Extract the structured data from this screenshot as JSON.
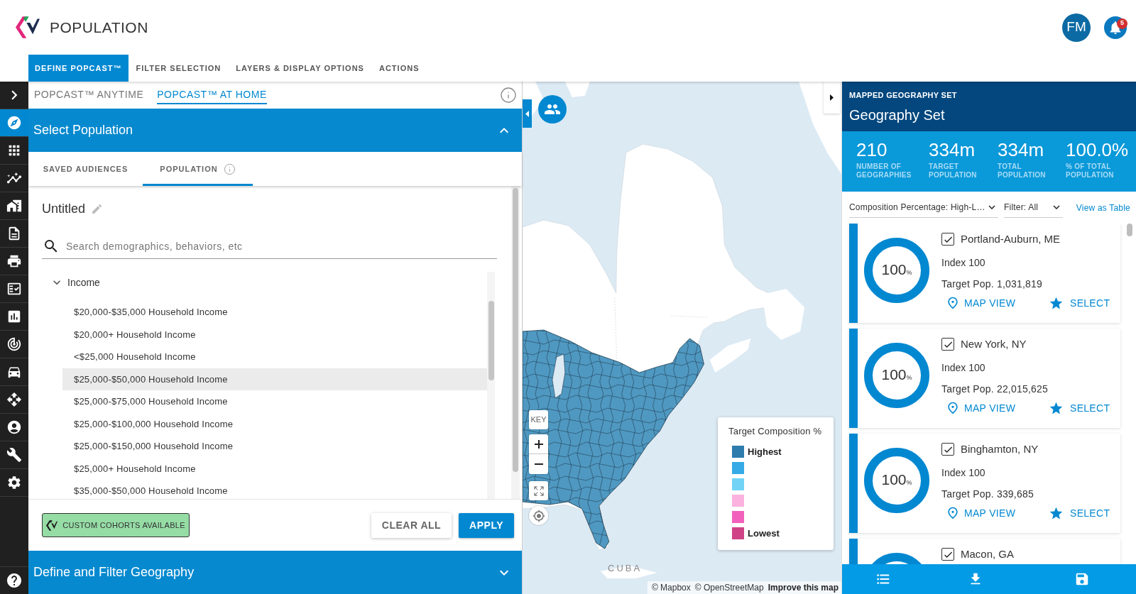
{
  "header": {
    "app_title": "POPULATION",
    "avatar_initials": "FM",
    "notification_count": "5"
  },
  "main_tabs": [
    {
      "label": "DEFINE POPCAST™",
      "selected": true
    },
    {
      "label": "FILTER SELECTION",
      "selected": false
    },
    {
      "label": "LAYERS & DISPLAY OPTIONS",
      "selected": false
    },
    {
      "label": "ACTIONS",
      "selected": false
    }
  ],
  "sidebar": {
    "items": [
      {
        "selected": true
      },
      {
        "selected": false
      },
      {
        "selected": false
      },
      {
        "selected": false
      },
      {
        "selected": false
      },
      {
        "selected": false
      },
      {
        "selected": false
      },
      {
        "selected": false
      },
      {
        "selected": false
      },
      {
        "selected": false
      },
      {
        "selected": false
      },
      {
        "selected": false
      },
      {
        "selected": false
      },
      {
        "selected": false
      }
    ]
  },
  "left_panel": {
    "subtabs": [
      {
        "label": "POPCAST™ ANYTIME",
        "selected": false
      },
      {
        "label": "POPCAST™ AT HOME",
        "selected": true
      }
    ],
    "select_population": {
      "title": "Select Population",
      "expanded": true,
      "tabs": [
        {
          "label": "SAVED AUDIENCES",
          "selected": false,
          "info_icon": false
        },
        {
          "label": "POPULATION",
          "selected": true,
          "info_icon": true
        }
      ],
      "audience_name": "Untitled",
      "search": {
        "placeholder": "Search demographics, behaviors, etc"
      },
      "tree": [
        {
          "label": "Income",
          "expanded": true,
          "children": [
            {
              "label": "$20,000-$35,000 Household Income",
              "highlighted": false
            },
            {
              "label": "$20,000+ Household Income",
              "highlighted": false
            },
            {
              "label": "<$25,000 Household Income",
              "highlighted": false
            },
            {
              "label": "$25,000-$50,000 Household Income",
              "highlighted": true
            },
            {
              "label": "$25,000-$75,000 Household Income",
              "highlighted": false
            },
            {
              "label": "$25,000-$100,000 Household Income",
              "highlighted": false
            },
            {
              "label": "$25,000-$150,000 Household Income",
              "highlighted": false
            },
            {
              "label": "$25,000+ Household Income",
              "highlighted": false
            },
            {
              "label": "$35,000-$50,000 Household Income",
              "highlighted": false
            }
          ]
        }
      ]
    },
    "custom_cohorts_button": "CUSTOM COHORTS AVAILABLE",
    "actions": [
      {
        "label": "CLEAR ALL",
        "kind": "secondary"
      },
      {
        "label": "APPLY",
        "kind": "primary"
      }
    ],
    "geography_section": {
      "title": "Define and Filter Geography",
      "expanded": false
    }
  },
  "map": {
    "place_label": "CUBA",
    "key_button": "KEY",
    "legend": {
      "title": "Target Composition %",
      "items": [
        {
          "color": "#2e7bad",
          "label": "Highest"
        },
        {
          "color": "#35aae6"
        },
        {
          "color": "#72d3f6"
        },
        {
          "color": "#fbb2de"
        },
        {
          "color": "#f262bd"
        },
        {
          "color": "#cf4487",
          "label": "Lowest"
        }
      ]
    },
    "attribution": [
      {
        "text": "© Mapbox",
        "bold": false
      },
      {
        "text": "© OpenStreetMap",
        "bold": false
      },
      {
        "text": "Improve this map",
        "bold": true
      }
    ]
  },
  "geography_set": {
    "overline": "MAPPED GEOGRAPHY SET",
    "title": "Geography Set",
    "stats": [
      {
        "value": "210",
        "label": "NUMBER OF GEOGRAPHIES"
      },
      {
        "value": "334m",
        "label": "TARGET POPULATION"
      },
      {
        "value": "334m",
        "label": "TOTAL POPULATION"
      },
      {
        "value": "100.0%",
        "label": "% OF TOTAL POPULATION"
      }
    ],
    "sort_select": "Composition Percentage: High-L…",
    "filter_select": "Filter: All",
    "view_link": "View as Table",
    "cards": [
      {
        "checked": true,
        "name": "Portland-Auburn, ME",
        "level": 1,
        "percent": "100",
        "unit": "%",
        "index": "Index 100",
        "target_pop": "Target Pop. 1,031,819",
        "map_view": "MAP VIEW",
        "select": "SELECT"
      },
      {
        "checked": true,
        "name": "New York, NY",
        "level": 1,
        "percent": "100",
        "unit": "%",
        "index": "Index 100",
        "target_pop": "Target Pop. 22,015,625",
        "map_view": "MAP VIEW",
        "select": "SELECT"
      },
      {
        "checked": true,
        "name": "Binghamton, NY",
        "level": 1,
        "percent": "100",
        "unit": "%",
        "index": "Index 100",
        "target_pop": "Target Pop. 339,685",
        "map_view": "MAP VIEW",
        "select": "SELECT"
      },
      {
        "checked": true,
        "name": "Macon, GA"
      }
    ]
  }
}
